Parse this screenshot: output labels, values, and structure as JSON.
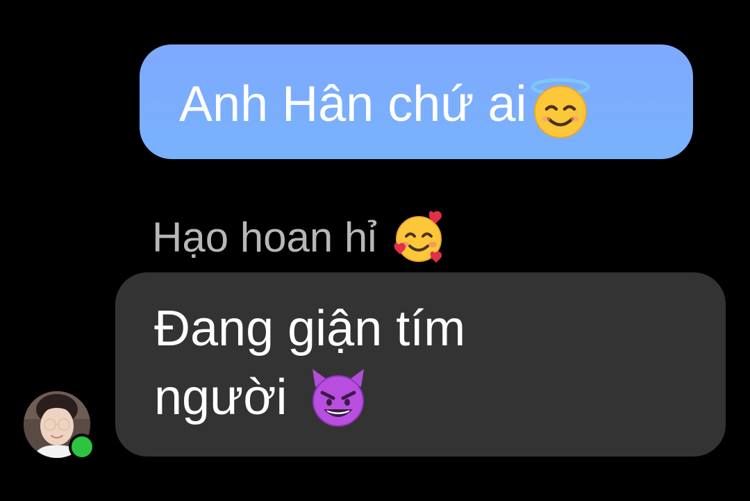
{
  "conversation": {
    "outgoing_message": {
      "text": "Anh Hân chứ ai",
      "emoji": "smiling-face-with-halo-icon",
      "bubble_color": "#7FA9FF"
    },
    "incoming_sender": {
      "name": "Hạo hoan hỉ",
      "emoji": "smiling-face-with-hearts-icon"
    },
    "incoming_message": {
      "line1": "Đang giận tím",
      "line2": "người",
      "emoji": "smiling-face-with-horns-icon",
      "bubble_color": "#333333"
    },
    "contact": {
      "avatar": "avatar-photo",
      "online": true,
      "online_color": "#2FC43F"
    }
  },
  "theme": {
    "background": "#000000",
    "sender_name_color": "#B7B7B7",
    "text_color": "#FFFFFF"
  }
}
